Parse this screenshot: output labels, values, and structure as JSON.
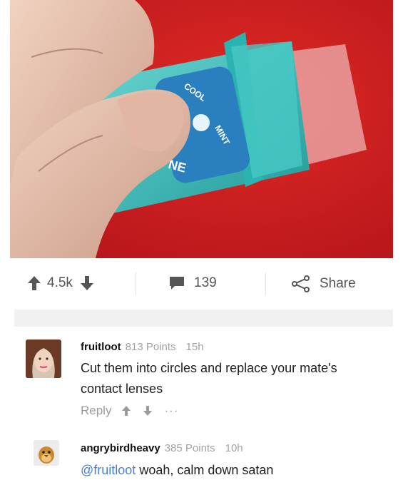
{
  "post": {
    "photo_text_1": "COOL",
    "photo_text_2": "MINT",
    "photo_text_3": "NE",
    "score": "4.5k",
    "comment_count": "139",
    "share_label": "Share"
  },
  "comments": [
    {
      "user": "fruitloot",
      "points": "813 Points",
      "age": "15h",
      "text": "Cut them into circles and replace your mate's contact lenses",
      "reply_label": "Reply",
      "more": "···"
    },
    {
      "user": "angrybirdheavy",
      "points": "385 Points",
      "age": "10h",
      "mention": "@fruitloot",
      "text": " woah, calm down satan"
    }
  ],
  "colors": {
    "photo_background": "#d41f1f",
    "container_teal": "#3cc4c0",
    "mention": "#4a7fcf"
  }
}
